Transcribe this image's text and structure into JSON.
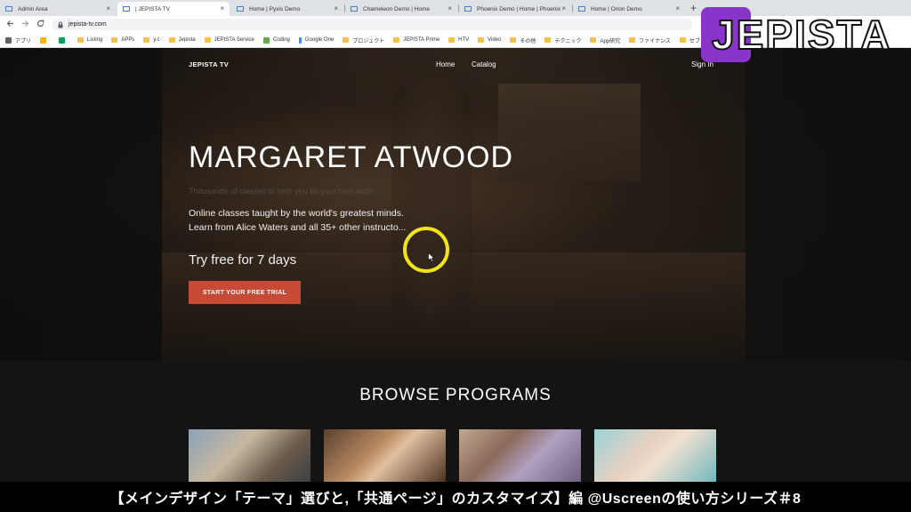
{
  "browser": {
    "tabs": [
      {
        "label": "Admin Area",
        "active": false
      },
      {
        "label": "| JEPISTA TV",
        "active": true
      },
      {
        "label": "Home | Pyxis Demo",
        "active": false
      },
      {
        "label": "Chameleon Demo | Home",
        "active": false
      },
      {
        "label": "Phoenix Demo | Home | Phoenix",
        "active": false
      },
      {
        "label": "Home | Orion Demo",
        "active": false
      }
    ],
    "close_glyph": "×",
    "new_tab_glyph": "+",
    "url": "jepista-tv.com",
    "bookmarks": [
      "アプリ",
      "",
      "",
      "Listing",
      "APPs",
      "y.c",
      "Jepista",
      "JEPISTA Service",
      "Coding",
      "Google One",
      "プロジェクト",
      "JEPISTA Prime",
      "HTV",
      "Video",
      "その他",
      "テクニック",
      "App研究",
      "ファイナンス",
      "セブ"
    ]
  },
  "site": {
    "brand": "JEPISTA TV",
    "nav": {
      "home": "Home",
      "catalog": "Catalog",
      "sign_in": "Sign In"
    },
    "hero": {
      "title": "MARGARET ATWOOD",
      "subtitle": "Thousands of classes to help you do your best work.",
      "desc_line1": "Online classes taught by the world's greatest minds.",
      "desc_line2": "Learn from Alice Waters and all 35+ other instructo...",
      "try": "Try free for 7 days",
      "cta": "START YOUR FREE TRIAL"
    },
    "browse": {
      "title": "BROWSE PROGRAMS"
    }
  },
  "overlay": {
    "caption": "【メインデザイン「テーマ」選びと,「共通ページ」のカスタマイズ】編 @Uscreenの使い方シリーズ＃8",
    "logo": "JEPISTA"
  },
  "colors": {
    "cta": "#c64a36",
    "cursor_ring": "#f3e41a",
    "logo_badge": "#8a35c9"
  }
}
